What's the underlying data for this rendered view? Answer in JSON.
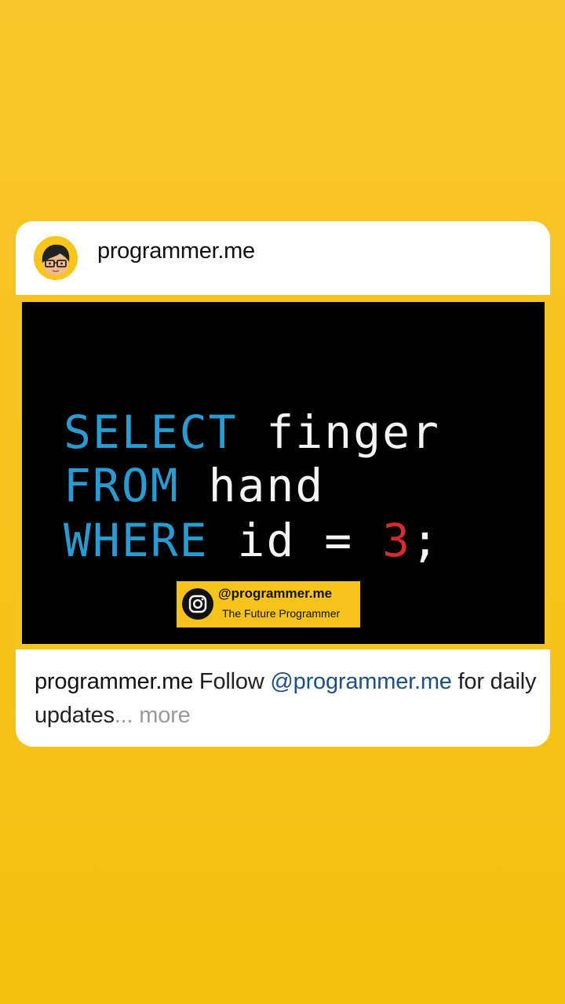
{
  "post": {
    "username": "programmer.me",
    "avatar_icon": "boy-with-glasses-avatar-icon",
    "image": {
      "code_lines": [
        {
          "keyword": "SELECT",
          "rest": " finger"
        },
        {
          "keyword": "FROM",
          "rest": " hand"
        },
        {
          "keyword": "WHERE",
          "rest": " id = ",
          "number": "3",
          "end": ";"
        }
      ],
      "badge_icon": "instagram-icon",
      "badge_handle": "@programmer.me",
      "badge_tagline": "The Future Programmer"
    },
    "caption": {
      "username": "programmer.me",
      "text_before": " Follow ",
      "mention": "@programmer.me",
      "text_after": " for daily updates",
      "ellipsis": "...",
      "more_label": " more"
    }
  },
  "colors": {
    "background": "#f6c21c",
    "keyword": "#2a9bd0",
    "identifier": "#f4f4f4",
    "number": "#d22c2c",
    "mention": "#1f4f80",
    "more": "#9a9a9a"
  }
}
